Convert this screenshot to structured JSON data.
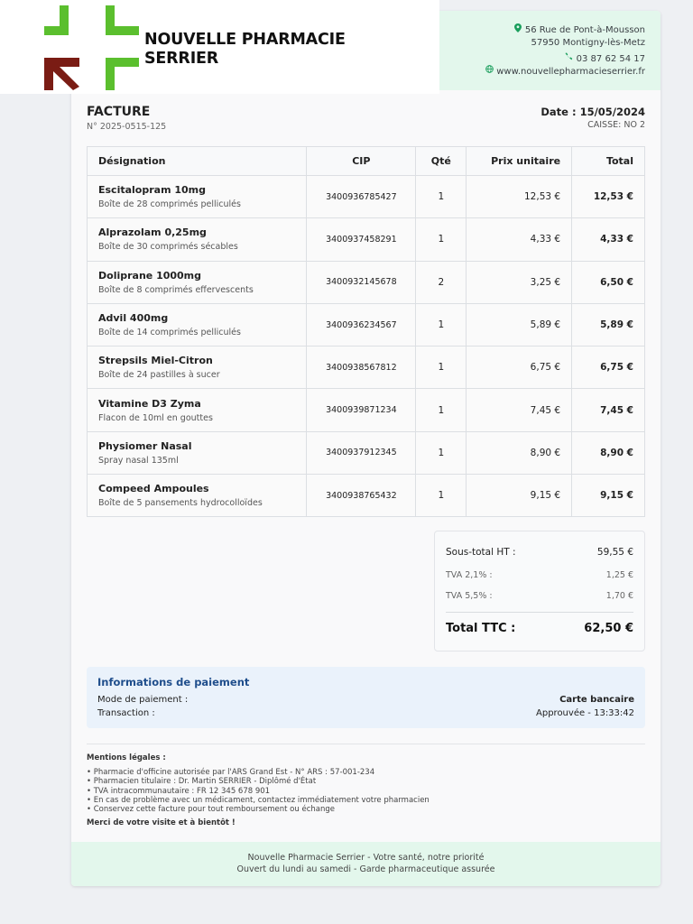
{
  "pharmacy": {
    "name_line1": "NOUVELLE PHARMACIE",
    "name_line2": "SERRIER",
    "address_line1": "56 Rue de Pont-à-Mousson",
    "address_line2": "57950 Montigny-lès-Metz",
    "phone": "03 87 62 54 17",
    "website": "www.nouvellepharmacieserrier.fr",
    "logo_colors": {
      "green": "#5bbf2e",
      "dark_red": "#7a1c14"
    }
  },
  "invoice": {
    "title": "FACTURE",
    "number": "N° 2025-0515-125",
    "date": "Date : 15/05/2024",
    "register": "CAISSE: NO 2"
  },
  "table": {
    "headers": {
      "designation": "Désignation",
      "cip": "CIP",
      "qty": "Qté",
      "unit_price": "Prix unitaire",
      "total": "Total"
    },
    "rows": [
      {
        "name": "Escitalopram 10mg",
        "desc": "Boîte de 28 comprimés pelliculés",
        "cip": "3400936785427",
        "qty": "1",
        "unit_price": "12,53 €",
        "total": "12,53 €"
      },
      {
        "name": "Alprazolam 0,25mg",
        "desc": "Boîte de 30 comprimés sécables",
        "cip": "3400937458291",
        "qty": "1",
        "unit_price": "4,33 €",
        "total": "4,33 €"
      },
      {
        "name": "Doliprane 1000mg",
        "desc": "Boîte de 8 comprimés effervescents",
        "cip": "3400932145678",
        "qty": "2",
        "unit_price": "3,25 €",
        "total": "6,50 €"
      },
      {
        "name": "Advil 400mg",
        "desc": "Boîte de 14 comprimés pelliculés",
        "cip": "3400936234567",
        "qty": "1",
        "unit_price": "5,89 €",
        "total": "5,89 €"
      },
      {
        "name": "Strepsils Miel-Citron",
        "desc": "Boîte de 24 pastilles à sucer",
        "cip": "3400938567812",
        "qty": "1",
        "unit_price": "6,75 €",
        "total": "6,75 €"
      },
      {
        "name": "Vitamine D3 Zyma",
        "desc": "Flacon de 10ml en gouttes",
        "cip": "3400939871234",
        "qty": "1",
        "unit_price": "7,45 €",
        "total": "7,45 €"
      },
      {
        "name": "Physiomer Nasal",
        "desc": "Spray nasal 135ml",
        "cip": "3400937912345",
        "qty": "1",
        "unit_price": "8,90 €",
        "total": "8,90 €"
      },
      {
        "name": "Compeed Ampoules",
        "desc": "Boîte de 5 pansements hydrocolloïdes",
        "cip": "3400938765432",
        "qty": "1",
        "unit_price": "9,15 €",
        "total": "9,15 €"
      }
    ]
  },
  "totals": {
    "subtotal_label": "Sous-total HT :",
    "subtotal_value": "59,55 €",
    "tva1_label": "TVA 2,1% :",
    "tva1_value": "1,25 €",
    "tva2_label": "TVA 5,5% :",
    "tva2_value": "1,70 €",
    "ttc_label": "Total TTC :",
    "ttc_value": "62,50 €"
  },
  "payment": {
    "title": "Informations de paiement",
    "mode_label": "Mode de paiement :",
    "mode_value": "Carte bancaire",
    "transaction_label": "Transaction :",
    "transaction_value": "Approuvée - 13:33:42"
  },
  "legal": {
    "title": "Mentions légales :",
    "items": [
      "Pharmacie d'officine autorisée par l'ARS Grand Est - N° ARS : 57-001-234",
      "Pharmacien titulaire : Dr. Martin SERRIER - Diplômé d'État",
      "TVA intracommunautaire : FR 12 345 678 901",
      "En cas de problème avec un médicament, contactez immédiatement votre pharmacien",
      "Conservez cette facture pour tout remboursement ou échange"
    ],
    "thanks": "Merci de votre visite et à bientôt !"
  },
  "footer": {
    "line1": "Nouvelle Pharmacie Serrier - Votre santé, notre priorité",
    "line2": "Ouvert du lundi au samedi - Garde pharmaceutique assurée"
  }
}
